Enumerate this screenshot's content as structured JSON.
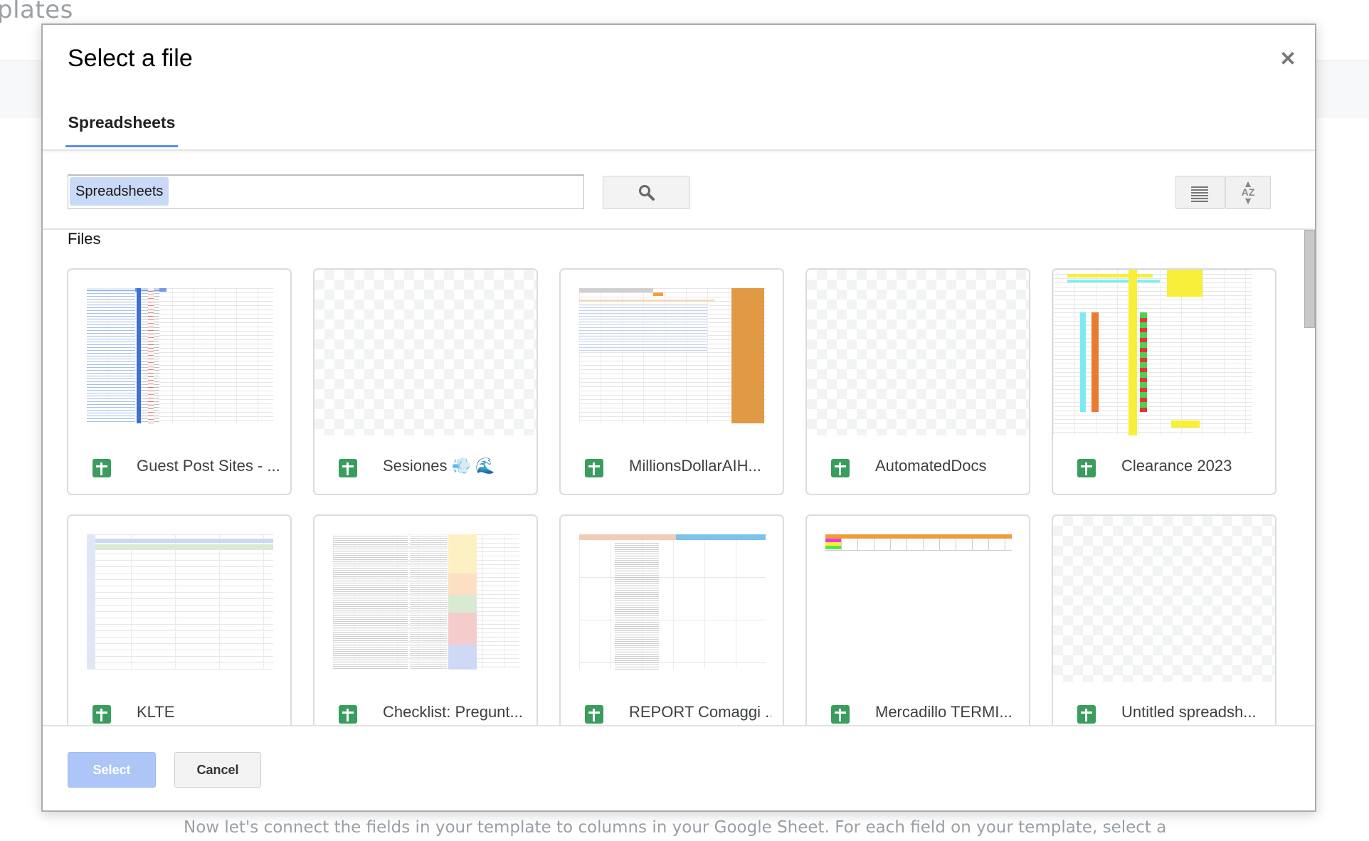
{
  "background": {
    "heading_fragment": "plates",
    "instruction_text": "Now let's connect the fields in your template to columns in your Google Sheet. For each field on your template, select a"
  },
  "dialog": {
    "title": "Select a file",
    "close_icon": "close-icon",
    "tabs": [
      {
        "label": "Spreadsheets",
        "active": true
      }
    ],
    "search": {
      "chip_label": "Spreadsheets",
      "value": "",
      "search_icon": "search-icon"
    },
    "view_controls": {
      "list_view_icon": "list-view-icon",
      "sort_icon": "sort-az-icon",
      "sort_label": "AZ"
    },
    "section_label": "Files",
    "files": [
      {
        "name": "Guest Post Sites - ...",
        "type": "spreadsheet",
        "thumbnail": "sheet-preview-blue"
      },
      {
        "name": "Sesiones 💨 🌊",
        "type": "spreadsheet",
        "thumbnail": "empty"
      },
      {
        "name": "MillionsDollarAIH...",
        "type": "spreadsheet",
        "thumbnail": "sheet-preview-orange"
      },
      {
        "name": "AutomatedDocs",
        "type": "spreadsheet",
        "thumbnail": "empty"
      },
      {
        "name": "Clearance 2023",
        "type": "spreadsheet",
        "thumbnail": "sheet-preview-colorful"
      },
      {
        "name": "KLTE",
        "type": "spreadsheet",
        "thumbnail": "sheet-preview-table"
      },
      {
        "name": "Checklist: Pregunt...",
        "type": "spreadsheet",
        "thumbnail": "sheet-preview-text"
      },
      {
        "name": "REPORT Comaggi ...",
        "type": "spreadsheet",
        "thumbnail": "sheet-preview-report"
      },
      {
        "name": "Mercadillo TERMI...",
        "type": "spreadsheet",
        "thumbnail": "sheet-preview-small"
      },
      {
        "name": "Untitled spreadsh...",
        "type": "spreadsheet",
        "thumbnail": "empty"
      }
    ],
    "buttons": {
      "select_label": "Select",
      "select_enabled": false,
      "cancel_label": "Cancel"
    },
    "colors": {
      "accent": "#5a8ef0",
      "chip_bg": "#c9daf8",
      "sheets_icon": "#3a9d5d",
      "select_disabled_bg": "#adc6f7"
    }
  }
}
